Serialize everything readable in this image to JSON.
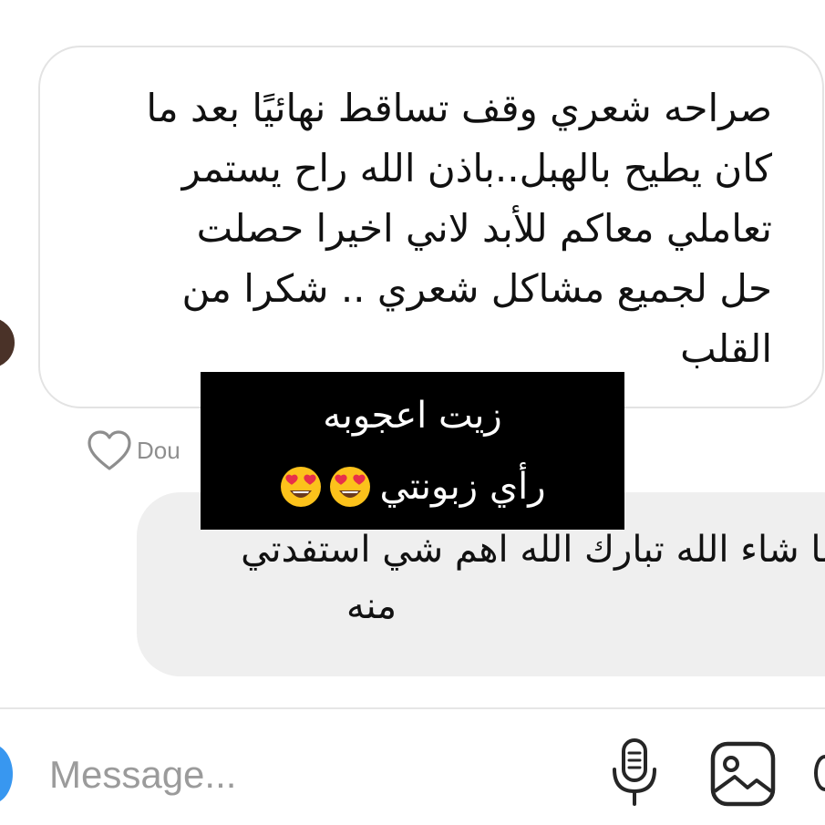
{
  "received_message": {
    "lines": [
      "صراحه شعري وقف تساقط نهائيًا بعد ما",
      "كان يطيح بالهبل..باذن الله راح يستمر",
      "تعاملي معاكم للأبد لاني اخيرا حصلت",
      "حل لجميع مشاكل شعري .. شكرا من",
      "القلب"
    ]
  },
  "reaction": {
    "like_label": "Dou"
  },
  "sent_message": {
    "line1": "ما شاء الله تبارك الله اهم شي استفدتي",
    "line2": "منه"
  },
  "overlay": {
    "title": "زيت اعجوبه",
    "subtitle": "رأي زبونتي",
    "emoji": [
      "heart-eyes-icon",
      "heart-eyes-icon"
    ]
  },
  "composer": {
    "placeholder": "Message...",
    "icons": [
      "camera-icon",
      "microphone-icon",
      "gallery-icon",
      "sticker-icon"
    ]
  },
  "colors": {
    "received_border": "#e3e3e3",
    "sent_bubble": "#efefef",
    "overlay_bg": "#000000",
    "camera_button": "#3897f0",
    "placeholder": "#9b9b9b"
  }
}
